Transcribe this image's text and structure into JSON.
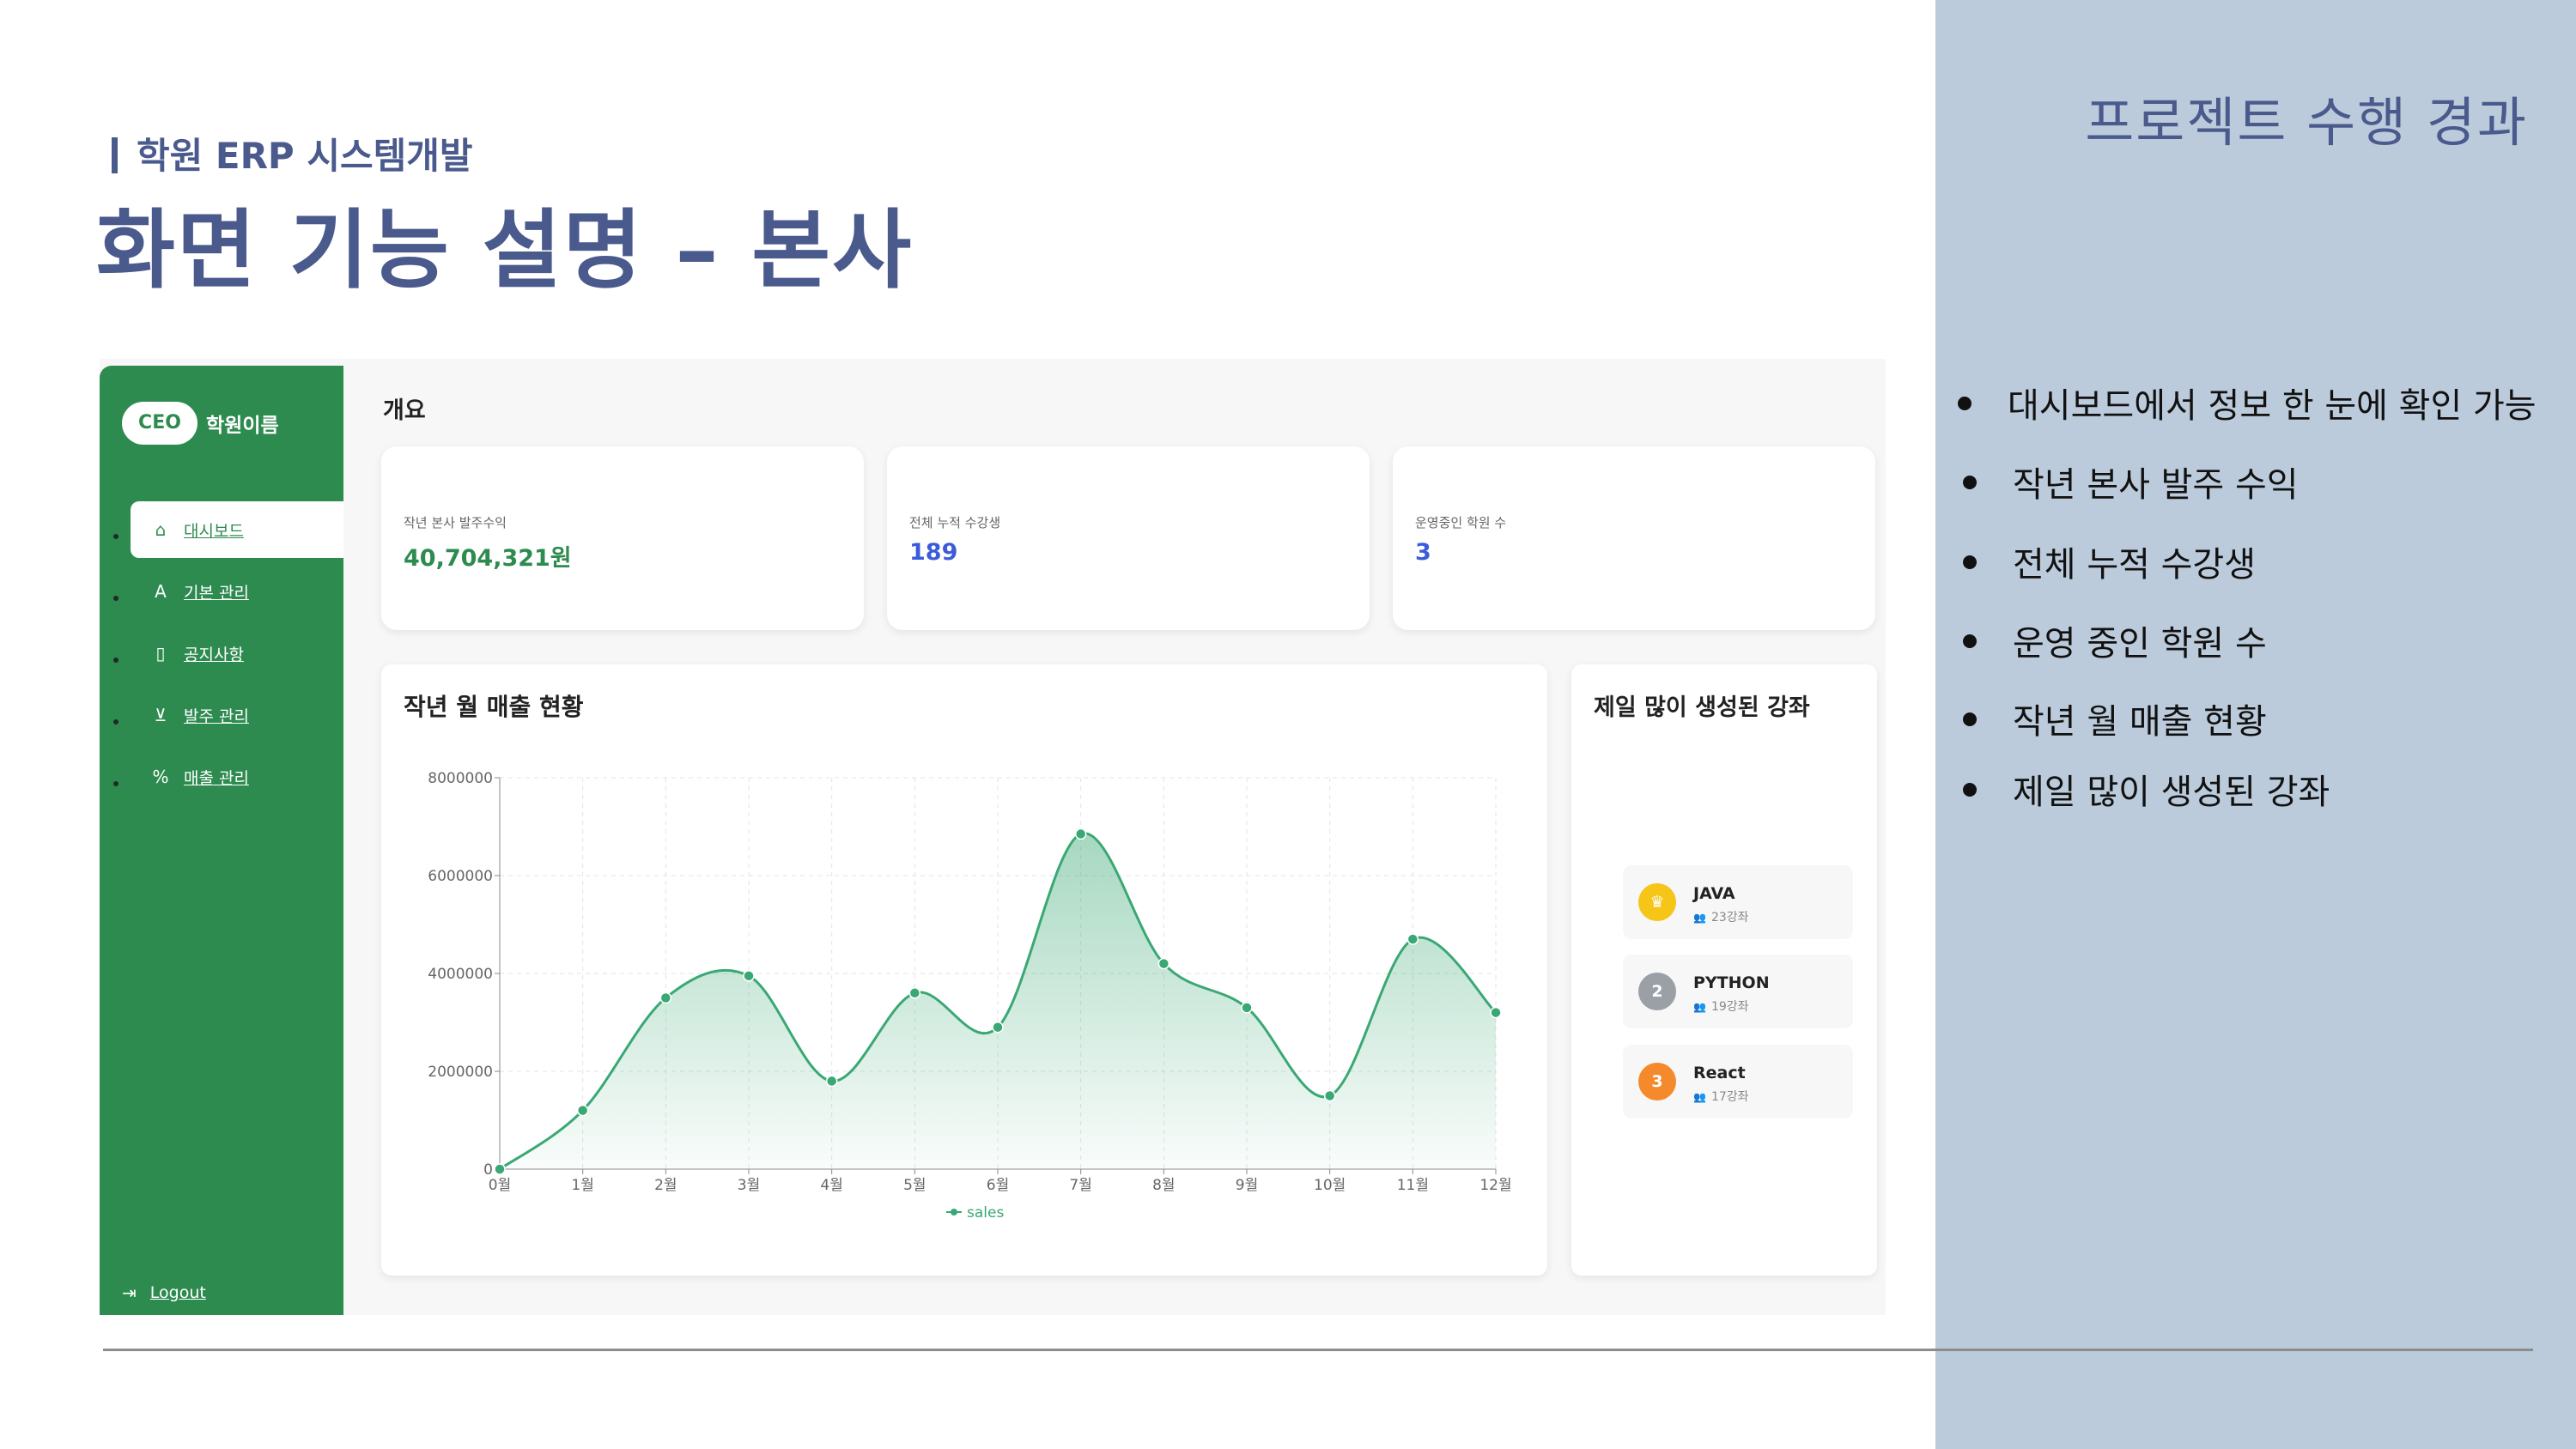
{
  "slide": {
    "subtitle": "학원 ERP 시스템개발",
    "title": "화면 기능 설명 – 본사",
    "panel_title": "프로젝트 수행 경과",
    "bullets": [
      "대시보드에서 정보 한 눈에 확인 가능",
      "작년 본사 발주 수익",
      "전체 누적 수강생",
      "운영 중인 학원 수",
      "작년 월 매출 현황",
      "제일 많이 생성된 강좌"
    ],
    "colors": {
      "panel_bg": "#bccbdb",
      "title": "#4a5a8c"
    }
  },
  "app": {
    "brand": {
      "badge": "CEO",
      "name": "학원이름"
    },
    "nav": [
      {
        "label": "대시보드",
        "icon": "home-icon",
        "active": true
      },
      {
        "label": "기본 관리",
        "icon": "letter-a-icon",
        "active": false
      },
      {
        "label": "공지사항",
        "icon": "document-icon",
        "active": false
      },
      {
        "label": "발주 관리",
        "icon": "cart-icon",
        "active": false
      },
      {
        "label": "매출 관리",
        "icon": "percent-icon",
        "active": false
      }
    ],
    "logout": "Logout",
    "section_title": "개요",
    "stats": [
      {
        "label": "작년 본사 발주수익",
        "value": "40,704,321원",
        "color": "#2e8b4f"
      },
      {
        "label": "전체 누적 수강생",
        "value": "189",
        "color": "#3b5bdb"
      },
      {
        "label": "운영중인 학원 수",
        "value": "3",
        "color": "#3b5bdb"
      }
    ],
    "chart_title": "작년 월 매출 현황",
    "ranking": {
      "title": "제일 많이 생성된 강좌",
      "items": [
        {
          "rank": "♛",
          "name": "JAVA",
          "count": "23강좌",
          "color": "#f5c518"
        },
        {
          "rank": "2",
          "name": "PYTHON",
          "count": "19강좌",
          "color": "#9aa0a6"
        },
        {
          "rank": "3",
          "name": "React",
          "count": "17강좌",
          "color": "#f58a2c"
        }
      ]
    },
    "colors": {
      "sidebar": "#2e8b4f",
      "line": "#3aa874"
    }
  },
  "chart_data": {
    "type": "area",
    "title": "작년 월 매출 현황",
    "categories": [
      "0월",
      "1월",
      "2월",
      "3월",
      "4월",
      "5월",
      "6월",
      "7월",
      "8월",
      "9월",
      "10월",
      "11월",
      "12월"
    ],
    "series": [
      {
        "name": "sales",
        "values": [
          0,
          1200000,
          3500000,
          3950000,
          1800000,
          3600000,
          2900000,
          6850000,
          4200000,
          3300000,
          1500000,
          4700000,
          3200000
        ]
      }
    ],
    "yticks": [
      "0",
      "2000000",
      "4000000",
      "6000000",
      "8000000"
    ],
    "ylim": [
      0,
      8000000
    ],
    "grid": true,
    "legend": "bottom"
  }
}
